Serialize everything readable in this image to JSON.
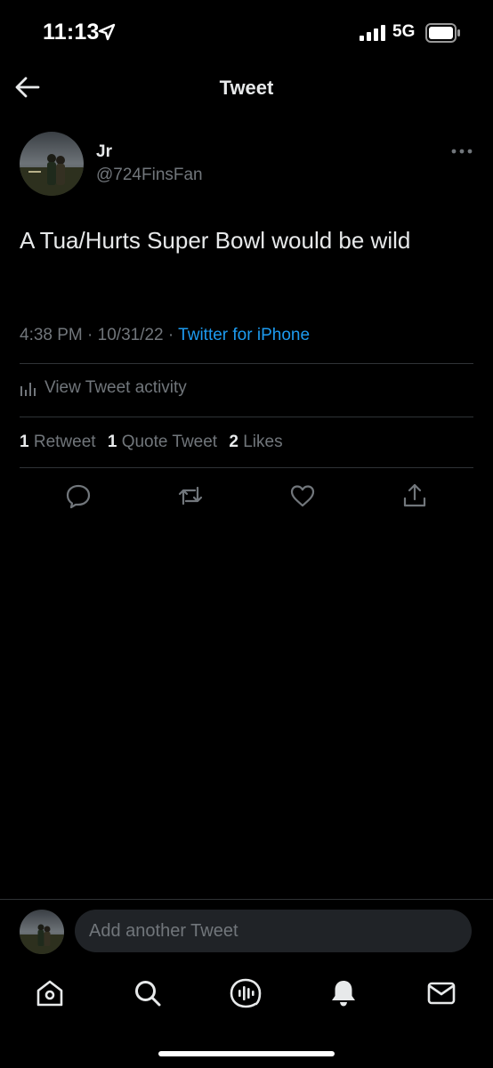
{
  "status_bar": {
    "time": "11:13",
    "network": "5G",
    "icons": [
      "location-arrow-icon",
      "signal-bars-icon",
      "battery-icon"
    ]
  },
  "header": {
    "title": "Tweet",
    "back_icon": "arrow-left-icon"
  },
  "tweet": {
    "author_name": "Jr",
    "author_handle": "@724FinsFan",
    "text": "A Tua/Hurts Super Bowl would be wild",
    "time": "4:38 PM",
    "separator": "·",
    "date": "10/31/22",
    "source": "Twitter for iPhone",
    "activity_label": "View Tweet activity",
    "stats": {
      "retweets_count": "1",
      "retweets_label": "Retweet",
      "quotes_count": "1",
      "quotes_label": "Quote Tweet",
      "likes_count": "2",
      "likes_label": "Likes"
    },
    "actions": [
      "reply-icon",
      "retweet-icon",
      "like-icon",
      "share-icon"
    ]
  },
  "reply_bar": {
    "placeholder": "Add another Tweet"
  },
  "bottom_nav": [
    "home-icon",
    "search-icon",
    "spaces-icon",
    "notifications-icon",
    "messages-icon"
  ],
  "colors": {
    "background": "#000000",
    "text_primary": "#e7e9ea",
    "text_secondary": "#71767b",
    "accent": "#1d9bf0",
    "divider": "#2f3336",
    "input_bg": "#202327"
  }
}
